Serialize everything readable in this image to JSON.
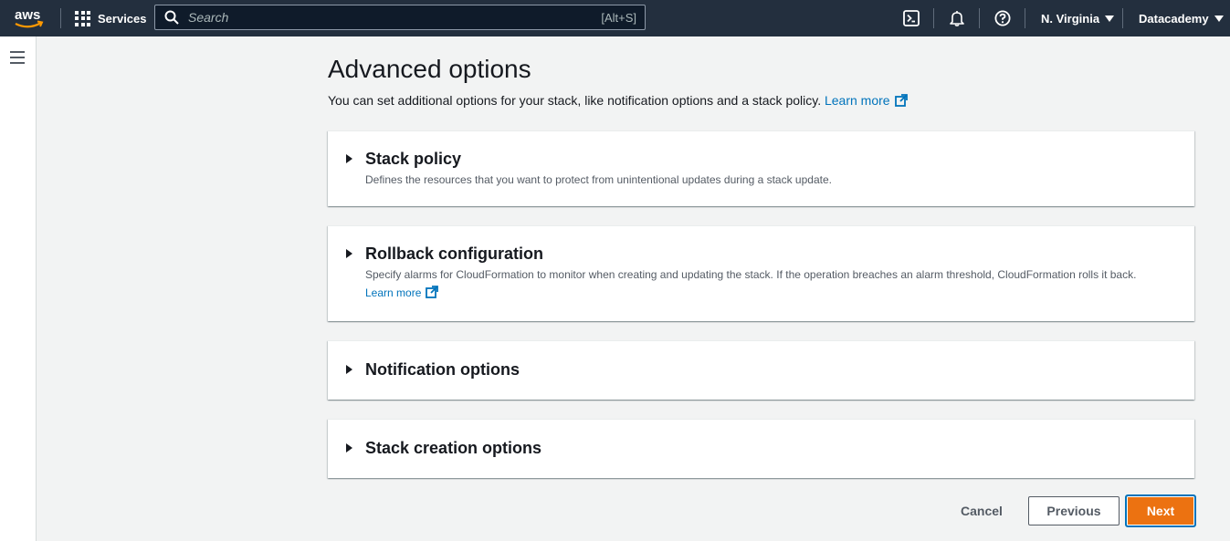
{
  "topnav": {
    "logo_text": "aws",
    "services_label": "Services",
    "search_placeholder": "Search",
    "search_shortcut": "[Alt+S]",
    "region_label": "N. Virginia",
    "account_label": "Datacademy",
    "bg_color": "#232f3e"
  },
  "main": {
    "title": "Advanced options",
    "description": "You can set additional options for your stack, like notification options and a stack policy.",
    "learn_more": "Learn more"
  },
  "sections": [
    {
      "title": "Stack policy",
      "description": "Defines the resources that you want to protect from unintentional updates during a stack update."
    },
    {
      "title": "Rollback configuration",
      "description": "Specify alarms for CloudFormation to monitor when creating and updating the stack. If the operation breaches an alarm threshold, CloudFormation rolls it back.",
      "learn_more": "Learn more"
    },
    {
      "title": "Notification options"
    },
    {
      "title": "Stack creation options"
    }
  ],
  "footer": {
    "cancel_label": "Cancel",
    "previous_label": "Previous",
    "next_label": "Next",
    "primary_color": "#ec7211",
    "link_color": "#0073bb"
  }
}
